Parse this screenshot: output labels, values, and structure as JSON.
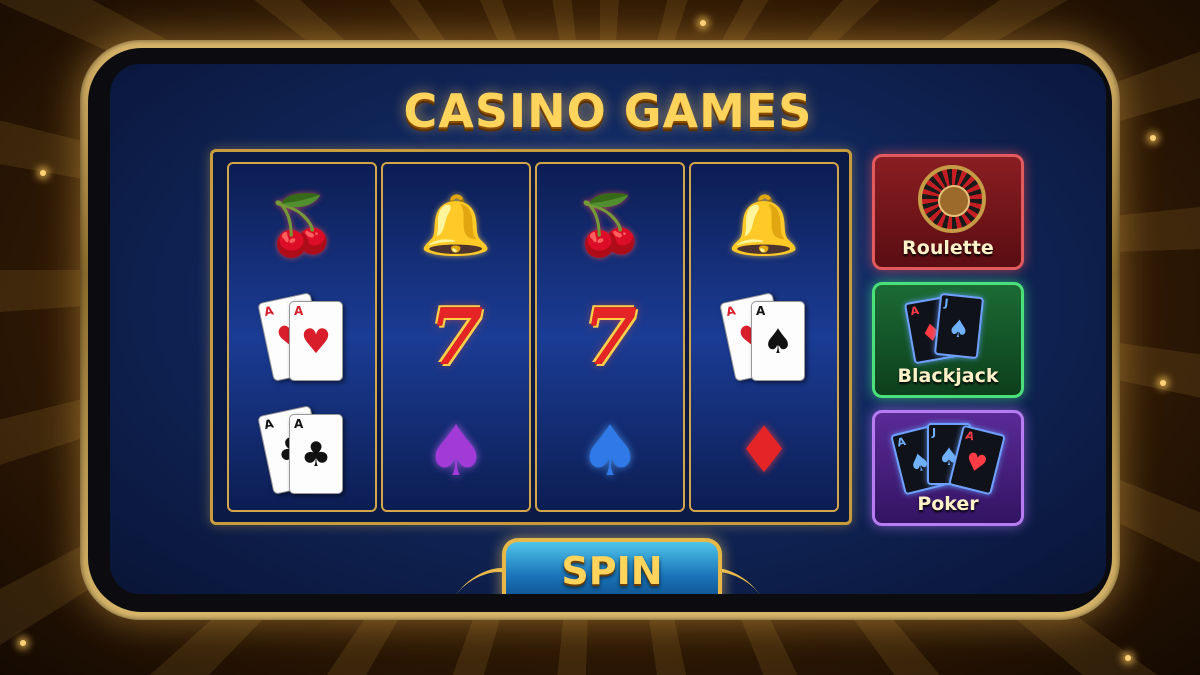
{
  "title": "CASINO GAMES",
  "reels": [
    {
      "symbols": [
        {
          "icon": "cherry-icon",
          "glyph": "🍒",
          "class": "cherry"
        },
        {
          "icon": "playing-cards-hearts-icon",
          "cards": [
            {
              "rank": "A",
              "suit": "♥",
              "color": "red"
            },
            {
              "rank": "A",
              "suit": "♥",
              "color": "red"
            }
          ]
        },
        {
          "icon": "playing-cards-clubs-icon",
          "cards": [
            {
              "rank": "A",
              "suit": "♣",
              "color": "black"
            },
            {
              "rank": "A",
              "suit": "♣",
              "color": "black"
            }
          ]
        }
      ]
    },
    {
      "symbols": [
        {
          "icon": "bell-icon",
          "glyph": "🔔",
          "class": "bell"
        },
        {
          "icon": "lucky-seven-icon",
          "glyph": "7",
          "class": "seven"
        },
        {
          "icon": "spade-purple-icon",
          "glyph": "♠",
          "class": "spade-purple"
        }
      ]
    },
    {
      "symbols": [
        {
          "icon": "cherry-icon",
          "glyph": "🍒",
          "class": "cherry"
        },
        {
          "icon": "lucky-seven-icon",
          "glyph": "7",
          "class": "seven"
        },
        {
          "icon": "spade-blue-icon",
          "glyph": "♠",
          "class": "spade-blue"
        }
      ]
    },
    {
      "symbols": [
        {
          "icon": "bell-icon",
          "glyph": "🔔",
          "class": "bell"
        },
        {
          "icon": "playing-cards-spades-icon",
          "cards": [
            {
              "rank": "A",
              "suit": "♥",
              "color": "red"
            },
            {
              "rank": "A",
              "suit": "♠",
              "color": "black"
            }
          ]
        },
        {
          "icon": "diamond-red-icon",
          "glyph": "♦",
          "class": "diamond-red"
        }
      ]
    }
  ],
  "games": {
    "roulette": {
      "label": "Roulette",
      "icon": "roulette-wheel-icon",
      "color": "#8a1e22"
    },
    "blackjack": {
      "label": "Blackjack",
      "icon": "blackjack-cards-icon",
      "color": "#1b6b34",
      "cards": [
        {
          "rank": "A",
          "suit": "♦",
          "color": "red"
        },
        {
          "rank": "J",
          "suit": "♠",
          "color": "blue"
        }
      ]
    },
    "poker": {
      "label": "Poker",
      "icon": "poker-cards-icon",
      "color": "#5a2a96",
      "cards": [
        {
          "rank": "A",
          "suit": "♠",
          "color": "blue"
        },
        {
          "rank": "J",
          "suit": "♠",
          "color": "blue"
        },
        {
          "rank": "A",
          "suit": "♥",
          "color": "red"
        }
      ]
    }
  },
  "spin": {
    "label": "SPIN",
    "color": "#1a74b8"
  },
  "colors": {
    "gold": "#ffd45c",
    "frame": "#c89b3c",
    "screen": "#0f2456"
  }
}
